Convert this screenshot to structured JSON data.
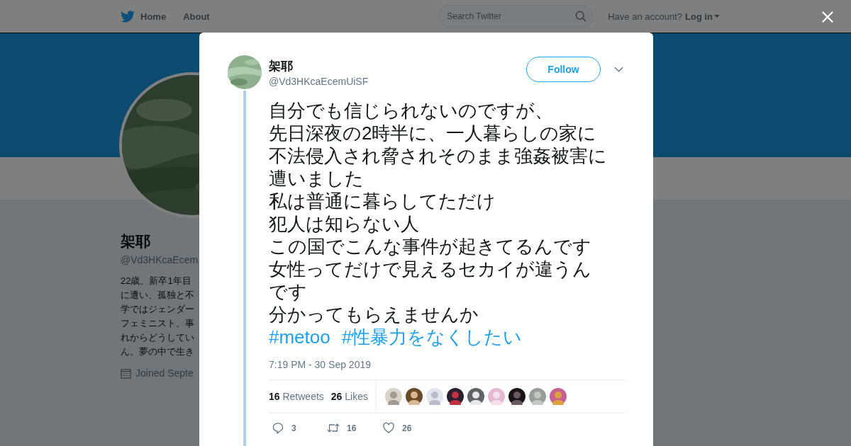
{
  "topnav": {
    "links": [
      "Home",
      "About"
    ],
    "search": {
      "placeholder": "Search Twitter"
    },
    "account_prompt": "Have an account?",
    "login": "Log in"
  },
  "profile": {
    "name": "架耶",
    "handle": "@Vd3HKcaEcem",
    "bio_lines": [
      "22歳。新卒1年目",
      "に遭い、孤独と不",
      "学ではジェンダー",
      "フェミニスト。事",
      "れからどうしてい",
      "ん。夢の中で生き"
    ],
    "joined": "Joined Septe"
  },
  "tweet": {
    "name": "架耶",
    "handle": "@Vd3HKcaEcemUiSF",
    "follow": "Follow",
    "lines": [
      "自分でも信じられないのですが、",
      "先日深夜の2時半に、一人暮らしの家に",
      "不法侵入され脅されそのまま強姦被害に",
      "遭いました",
      "私は普通に暮らしてただけ",
      "犯人は知らない人",
      "この国でこんな事件が起きてるんです",
      "女性ってだけで見えるセカイが違うん",
      "です",
      "分かってもらえませんか"
    ],
    "hashtags": [
      "#metoo",
      "#性暴力をなくしたい"
    ],
    "time": "7:19 PM - 30 Sep 2019",
    "retweets": {
      "count": "16",
      "label": "Retweets"
    },
    "likes": {
      "count": "26",
      "label": "Likes"
    },
    "likers": [
      {
        "kind": "picture"
      },
      {
        "kind": "picture"
      },
      {
        "kind": "picture"
      },
      {
        "kind": "picture"
      },
      {
        "kind": "picture"
      },
      {
        "kind": "picture"
      },
      {
        "kind": "picture"
      },
      {
        "kind": "picture"
      },
      {
        "kind": "picture"
      }
    ],
    "actions": [
      {
        "kind": "reply",
        "count": "3"
      },
      {
        "kind": "retweet",
        "count": "16"
      },
      {
        "kind": "like",
        "count": "26"
      }
    ]
  }
}
